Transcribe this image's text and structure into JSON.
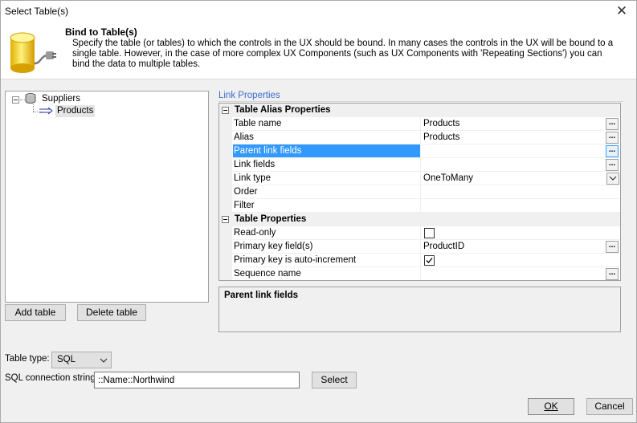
{
  "window": {
    "title": "Select Table(s)"
  },
  "header": {
    "title": "Bind to Table(s)",
    "description": "Specify the table (or tables) to which the controls in the UX should be bound. In many cases the controls in the UX will be bound to a single table. However, in the case of more complex UX Components (such as UX Components with 'Repeating Sections') you can bind the data to multiple tables."
  },
  "tree": {
    "root": "Suppliers",
    "child": "Products"
  },
  "buttons": {
    "add_table": "Add table",
    "delete_table": "Delete table",
    "select": "Select",
    "ok": "OK",
    "cancel": "Cancel"
  },
  "link_properties": {
    "group_label": "Link Properties",
    "categories": [
      {
        "name": "Table Alias Properties",
        "rows": [
          {
            "name": "Table name",
            "value": "Products"
          },
          {
            "name": "Alias",
            "value": "Products"
          },
          {
            "name": "Parent link fields",
            "value": ""
          },
          {
            "name": "Link fields",
            "value": ""
          },
          {
            "name": "Link type",
            "value": "OneToMany"
          },
          {
            "name": "Order",
            "value": ""
          },
          {
            "name": "Filter",
            "value": ""
          }
        ]
      },
      {
        "name": "Table Properties",
        "rows": [
          {
            "name": "Read-only",
            "value": "",
            "checked": false
          },
          {
            "name": "Primary key field(s)",
            "value": "ProductID"
          },
          {
            "name": "Primary key is auto-increment",
            "value": "",
            "checked": true
          },
          {
            "name": "Sequence name",
            "value": ""
          }
        ]
      }
    ],
    "selected_property": "Parent link fields"
  },
  "description_box": {
    "title": "Parent link fields"
  },
  "table_type": {
    "label": "Table type:",
    "value": "SQL"
  },
  "connection": {
    "label": "SQL connection string:",
    "value": "::Name::Northwind"
  },
  "colors": {
    "selection": "#3399ff",
    "group_label": "#3a6ecb",
    "background": "#f0f0f0"
  }
}
